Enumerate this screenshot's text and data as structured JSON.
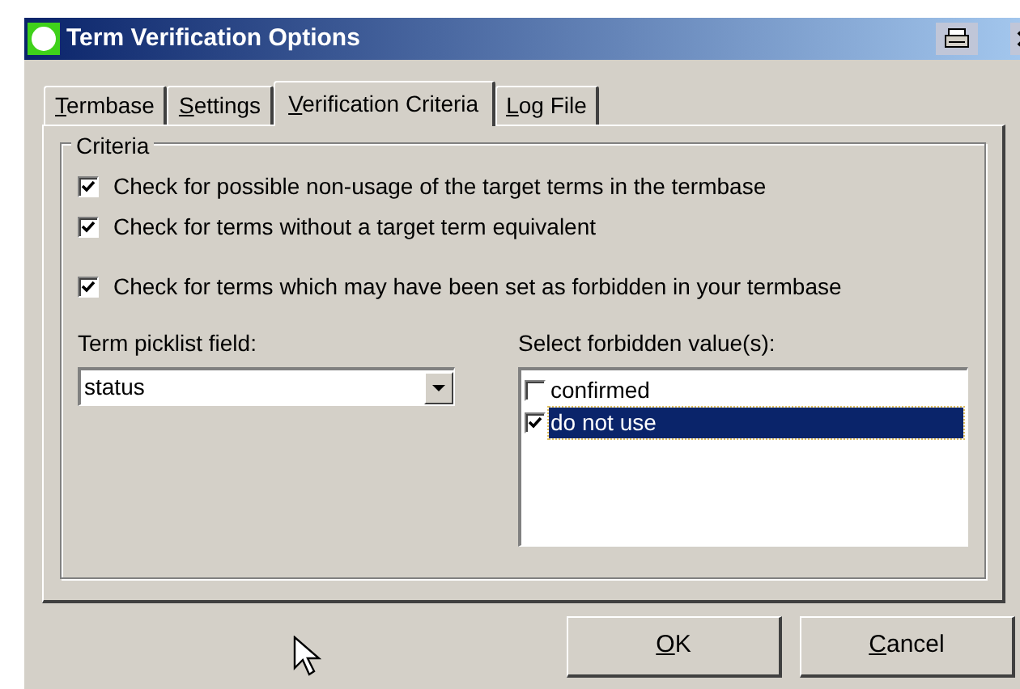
{
  "window": {
    "title": "Term Verification Options"
  },
  "tabs": [
    {
      "label": "Termbase",
      "selected": false
    },
    {
      "label": "Settings",
      "selected": false
    },
    {
      "label": "Verification Criteria",
      "selected": true
    },
    {
      "label": "Log File",
      "selected": false
    }
  ],
  "group": {
    "title": "Criteria"
  },
  "checks": [
    {
      "label": "Check for possible non-usage of the target terms in the termbase",
      "checked": true
    },
    {
      "label": "Check for terms without a target term equivalent",
      "checked": true
    },
    {
      "label": "Check for terms which may have been set as forbidden in your termbase",
      "checked": true
    }
  ],
  "picklist": {
    "label": "Term picklist field:",
    "value": "status"
  },
  "forbidden": {
    "label": "Select forbidden value(s):",
    "items": [
      {
        "label": "confirmed",
        "checked": false,
        "selected": false
      },
      {
        "label": "do not use",
        "checked": true,
        "selected": true
      }
    ]
  },
  "buttons": [
    "OK",
    "Cancel"
  ]
}
